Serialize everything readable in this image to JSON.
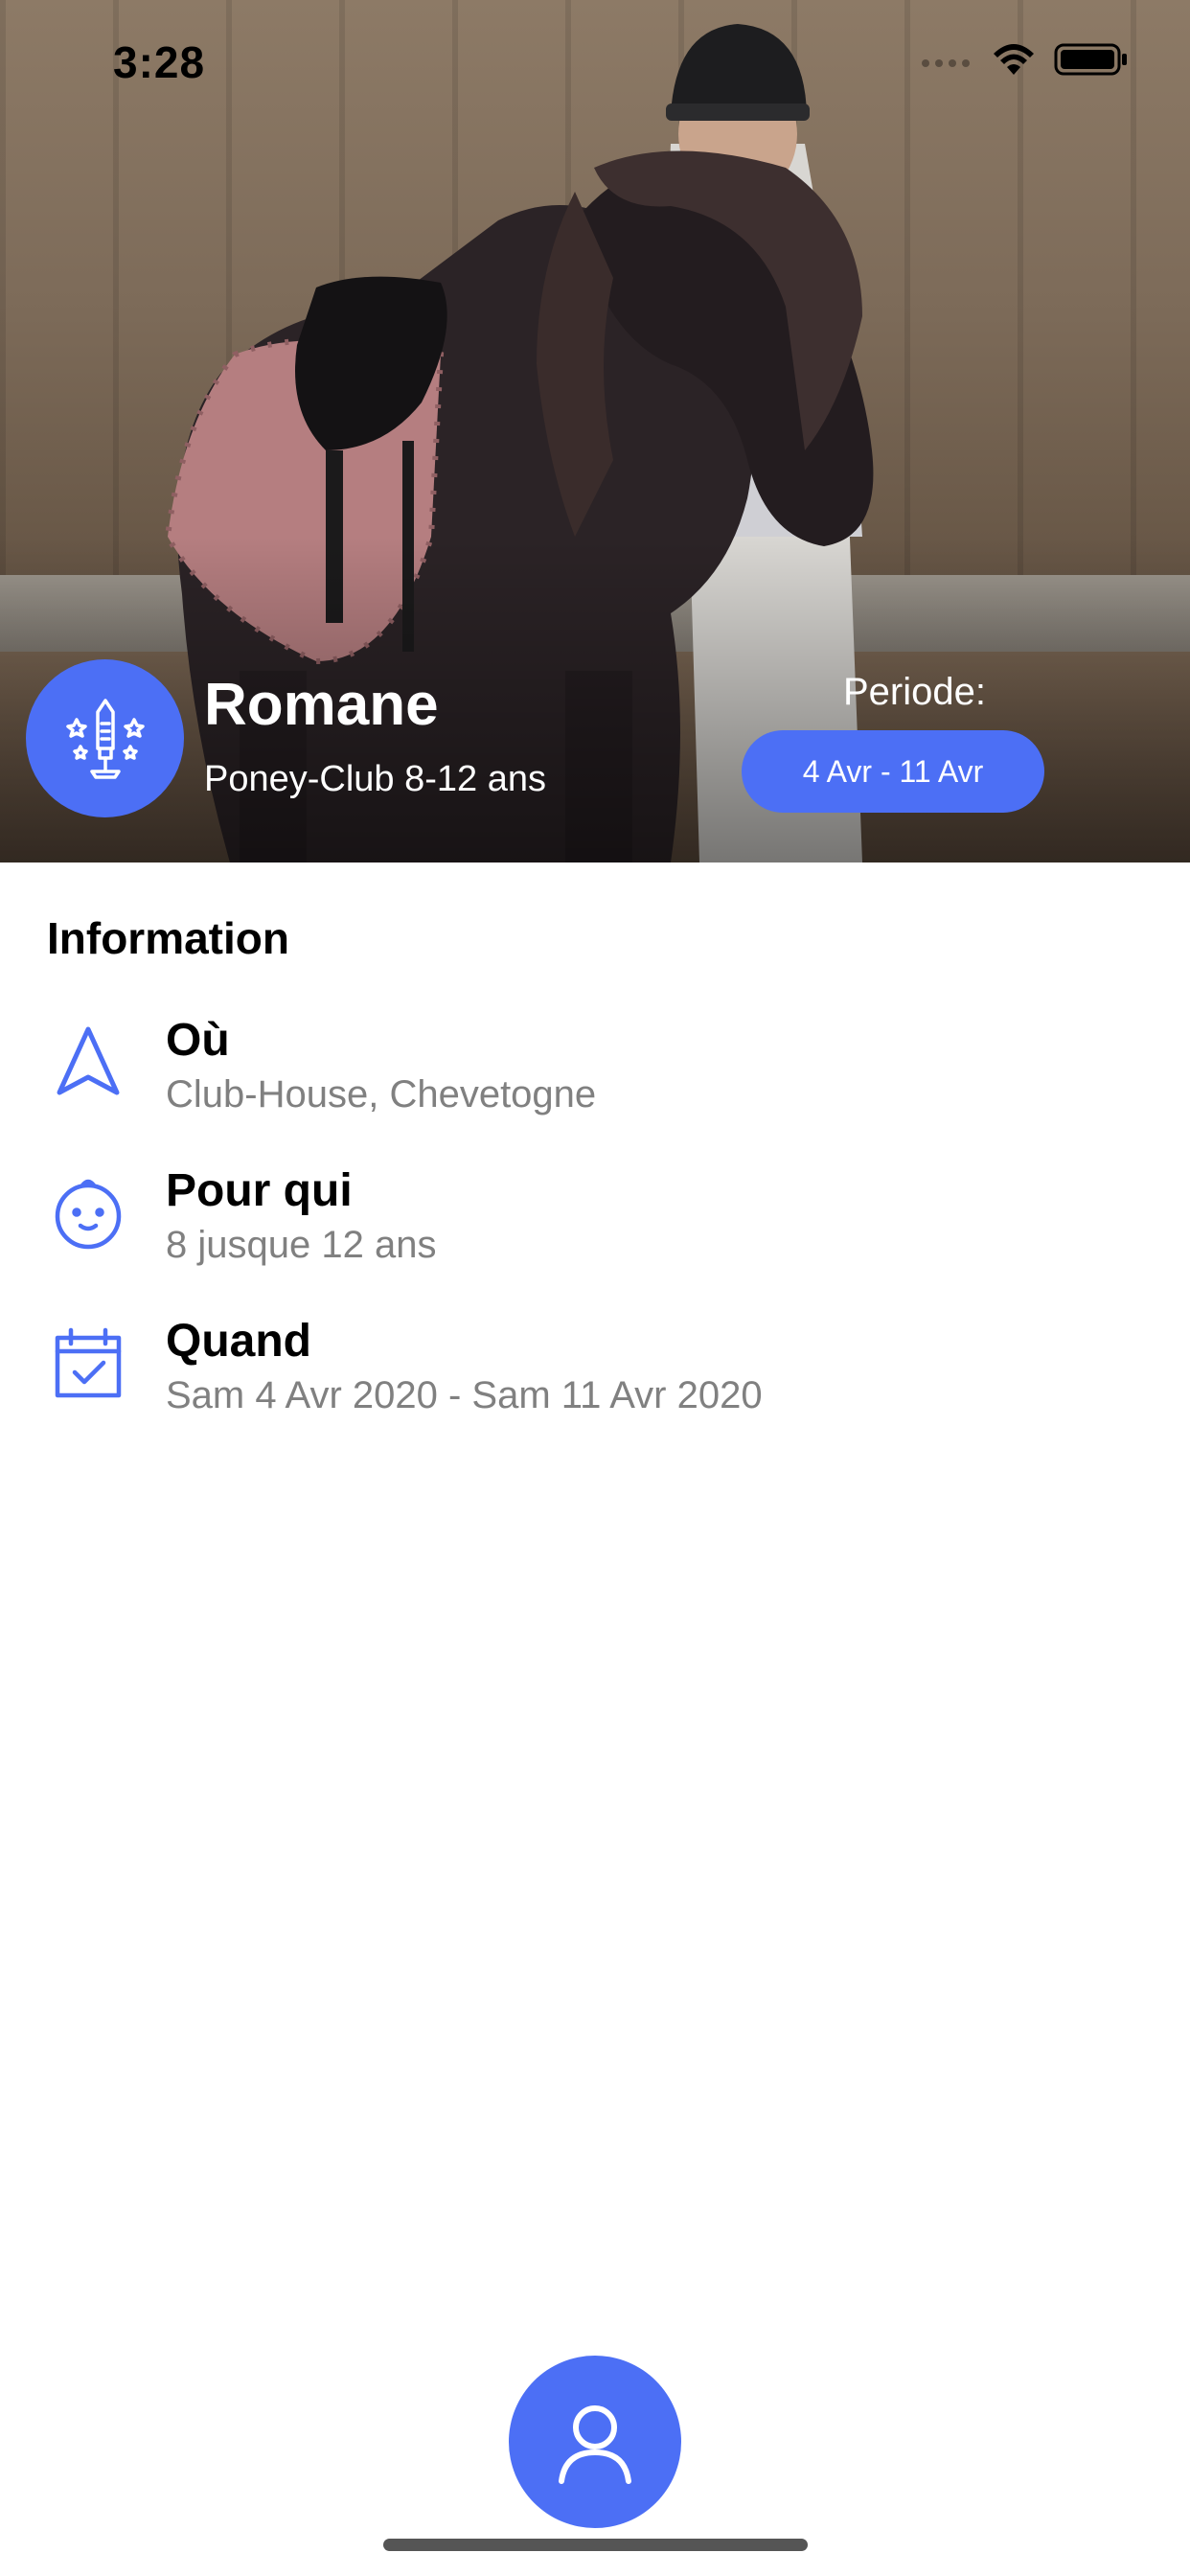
{
  "status_bar": {
    "time": "3:28"
  },
  "hero": {
    "title": "Romane",
    "subtitle": "Poney-Club 8-12 ans",
    "periode_label": "Periode:",
    "periode_value": "4 Avr - 11 Avr",
    "badge_icon": "fireworks-icon"
  },
  "information": {
    "title": "Information",
    "rows": [
      {
        "icon": "navigation-arrow-icon",
        "label": "Où",
        "value": "Club-House, Chevetogne"
      },
      {
        "icon": "baby-face-icon",
        "label": "Pour qui",
        "value": "8 jusque 12 ans"
      },
      {
        "icon": "calendar-check-icon",
        "label": "Quand",
        "value": "Sam 4 Avr 2020 - Sam 11 Avr 2020"
      }
    ]
  },
  "bottom": {
    "fab_icon": "user-icon"
  },
  "colors": {
    "accent": "#4c6ff5",
    "muted_text": "#808080"
  }
}
